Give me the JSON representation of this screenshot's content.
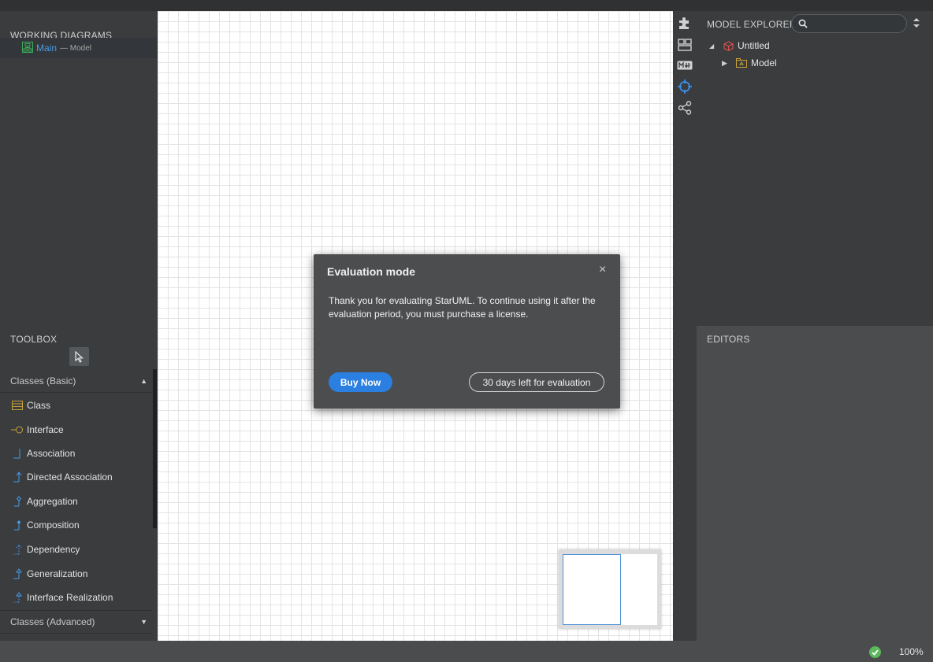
{
  "working_diagrams": {
    "title": "WORKING DIAGRAMS",
    "items": [
      {
        "name": "Main",
        "sub": "— Model",
        "icon": "class-diagram-icon"
      }
    ]
  },
  "toolbox": {
    "title": "TOOLBOX",
    "groups": [
      {
        "label": "Classes (Basic)",
        "expanded": true
      },
      {
        "label": "Classes (Advanced)",
        "expanded": false
      }
    ],
    "tools": [
      {
        "label": "Class",
        "icon": "class-icon"
      },
      {
        "label": "Interface",
        "icon": "interface-icon"
      },
      {
        "label": "Association",
        "icon": "association-icon"
      },
      {
        "label": "Directed Association",
        "icon": "directed-association-icon"
      },
      {
        "label": "Aggregation",
        "icon": "aggregation-icon"
      },
      {
        "label": "Composition",
        "icon": "composition-icon"
      },
      {
        "label": "Dependency",
        "icon": "dependency-icon"
      },
      {
        "label": "Generalization",
        "icon": "generalization-icon"
      },
      {
        "label": "Interface Realization",
        "icon": "interface-realization-icon"
      }
    ]
  },
  "model_explorer": {
    "title": "MODEL EXPLORER",
    "search_placeholder": "",
    "tree": [
      {
        "label": "Untitled",
        "icon": "project-icon",
        "expanded": true
      },
      {
        "label": "Model",
        "icon": "model-package-icon",
        "expanded": false
      }
    ]
  },
  "editors": {
    "title": "EDITORS"
  },
  "statusbar": {
    "zoom": "100%"
  },
  "dialog": {
    "title": "Evaluation mode",
    "body": "Thank you for evaluating StarUML. To continue using it after the evaluation period, you must purchase a license.",
    "buy_label": "Buy Now",
    "eval_label": "30 days left for evaluation"
  },
  "colors": {
    "accent": "#2a7fe0",
    "link": "#4a9be8",
    "tool_icon": "#4a9be8",
    "class_icon": "#c9a23a",
    "success": "#5cb85c"
  }
}
